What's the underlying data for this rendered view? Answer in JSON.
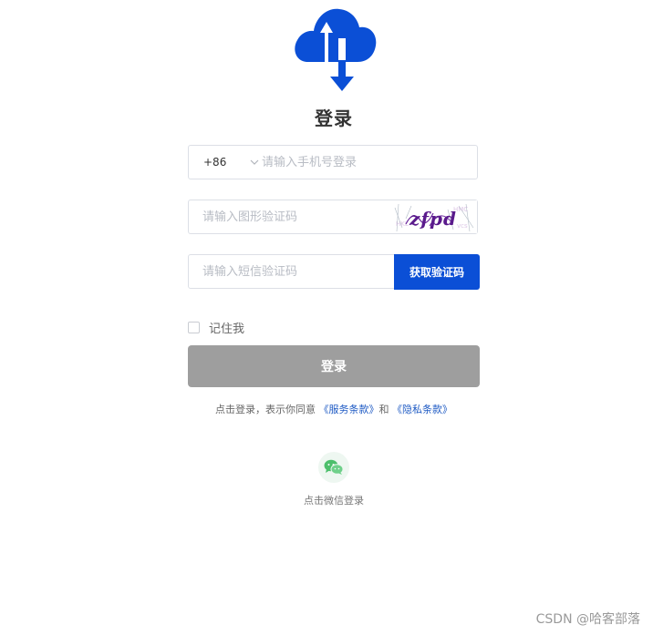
{
  "page": {
    "title": "登录"
  },
  "brand": {
    "logo_icon": "cloud-upload-download-icon",
    "accent_color": "#0b4fd6"
  },
  "form": {
    "country_code": "+86",
    "phone_placeholder": "请输入手机号登录",
    "captcha_placeholder": "请输入图形验证码",
    "captcha_image_text": "zfpd",
    "sms_placeholder": "请输入短信验证码",
    "sms_button_label": "获取验证码",
    "remember_label": "记住我",
    "login_button_label": "登录",
    "login_button_color": "#9e9e9e"
  },
  "agreement": {
    "prefix": "点击登录，表示你同意",
    "terms_link": "《服务条款》",
    "conjunction": "和",
    "privacy_link": "《隐私条款》"
  },
  "wechat": {
    "icon": "wechat-icon",
    "label": "点击微信登录"
  },
  "watermark": {
    "text": "CSDN @哈客部落"
  }
}
